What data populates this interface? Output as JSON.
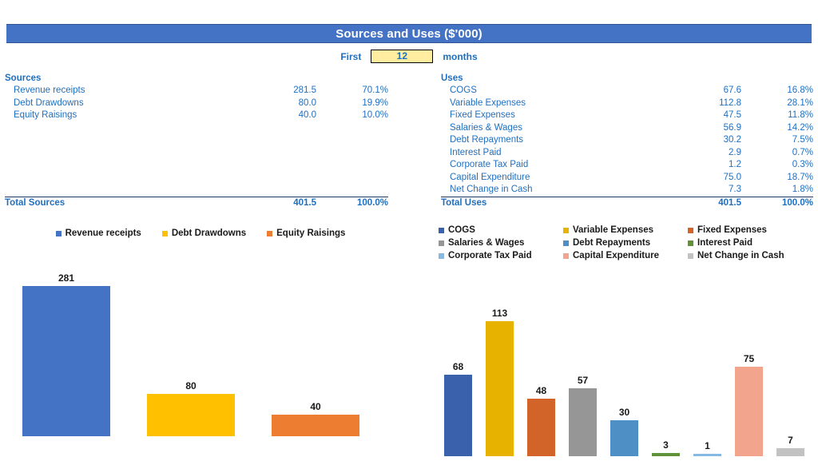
{
  "header": {
    "title": "Sources and Uses ($'000)",
    "bar_color": "#4472c4"
  },
  "controls": {
    "first_label": "First",
    "months_value": "12",
    "months_label": "months"
  },
  "sources_table": {
    "heading": "Sources",
    "rows": [
      {
        "name": "Revenue receipts",
        "value": "281.5",
        "percent": "70.1%"
      },
      {
        "name": "Debt Drawdowns",
        "value": "80.0",
        "percent": "19.9%"
      },
      {
        "name": "Equity Raisings",
        "value": "40.0",
        "percent": "10.0%"
      }
    ],
    "total": {
      "name": "Total Sources",
      "value": "401.5",
      "percent": "100.0%"
    }
  },
  "uses_table": {
    "heading": "Uses",
    "rows": [
      {
        "name": "COGS",
        "value": "67.6",
        "percent": "16.8%"
      },
      {
        "name": "Variable Expenses",
        "value": "112.8",
        "percent": "28.1%"
      },
      {
        "name": "Fixed Expenses",
        "value": "47.5",
        "percent": "11.8%"
      },
      {
        "name": "Salaries & Wages",
        "value": "56.9",
        "percent": "14.2%"
      },
      {
        "name": "Debt Repayments",
        "value": "30.2",
        "percent": "7.5%"
      },
      {
        "name": "Interest Paid",
        "value": "2.9",
        "percent": "0.7%"
      },
      {
        "name": "Corporate Tax Paid",
        "value": "1.2",
        "percent": "0.3%"
      },
      {
        "name": "Capital Expenditure",
        "value": "75.0",
        "percent": "18.7%"
      },
      {
        "name": "Net Change in Cash",
        "value": "7.3",
        "percent": "1.8%"
      }
    ],
    "total": {
      "name": "Total Uses",
      "value": "401.5",
      "percent": "100.0%"
    }
  },
  "chart_data": [
    {
      "id": "sources-chart",
      "type": "bar",
      "title": "",
      "xlabel": "",
      "ylabel": "",
      "legend_position": "top",
      "grid": false,
      "categories": [
        "Revenue receipts",
        "Debt Drawdowns",
        "Equity Raisings"
      ],
      "values": [
        281,
        80,
        40
      ],
      "data_labels": [
        "281",
        "80",
        "40"
      ],
      "colors": [
        "#4472c4",
        "#ffc000",
        "#ed7d31"
      ],
      "ylim": [
        0,
        295
      ]
    },
    {
      "id": "uses-chart",
      "type": "bar",
      "title": "",
      "xlabel": "",
      "ylabel": "",
      "legend_position": "top",
      "grid": false,
      "categories": [
        "COGS",
        "Variable Expenses",
        "Fixed Expenses",
        "Salaries & Wages",
        "Debt Repayments",
        "Interest Paid",
        "Corporate Tax Paid",
        "Capital Expenditure",
        "Net Change in Cash"
      ],
      "values": [
        68,
        113,
        48,
        57,
        30,
        3,
        1,
        75,
        7
      ],
      "data_labels": [
        "68",
        "113",
        "48",
        "57",
        "30",
        "3",
        "1",
        "75",
        "7"
      ],
      "colors": [
        "#3a61ab",
        "#e8b200",
        "#d2642a",
        "#969696",
        "#4e8fc6",
        "#609339",
        "#87bae3",
        "#f2a48c",
        "#c2c2c2"
      ],
      "ylim": [
        0,
        122
      ]
    }
  ]
}
